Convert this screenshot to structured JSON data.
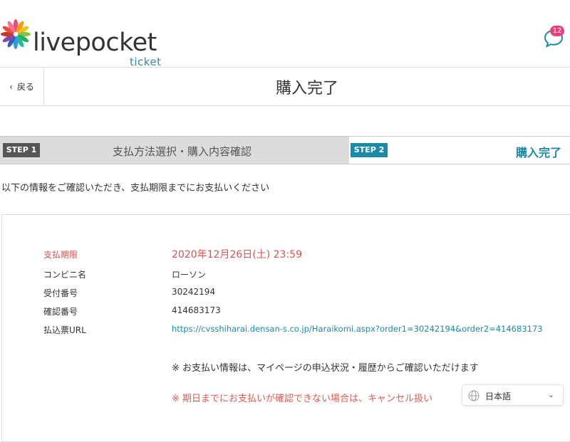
{
  "header": {
    "logo_text": "livepocket",
    "logo_sub": "ticket",
    "notification_count": "12"
  },
  "titlebar": {
    "back_label": "戻る",
    "title": "購入完了"
  },
  "steps": [
    {
      "tag": "STEP 1",
      "label": "支払方法選択・購入内容確認"
    },
    {
      "tag": "STEP 2",
      "label": "購入完了"
    }
  ],
  "intro": "以下の情報をご確認いただき、支払期限までにお支払いください",
  "payment": {
    "deadline_label": "支払期限",
    "deadline_value": "2020年12月26日(土) 23:59",
    "store_label": "コンビニ名",
    "store_value": "ローソン",
    "receipt_label": "受付番号",
    "receipt_value": "30242194",
    "confirm_label": "確認番号",
    "confirm_value": "414683173",
    "url_label": "払込票URL",
    "url_value": "https://cvsshiharai.densan-s.co.jp/Haraikomi.aspx?order1=30242194&order2=414683173"
  },
  "notes": {
    "note1": "※ お支払い情報は、マイページの申込状況・履歴からご確認いただけます",
    "note2": "※ 期日までにお支払いが確認できない場合は、キャンセル扱い"
  },
  "language": {
    "selected": "日本語"
  }
}
